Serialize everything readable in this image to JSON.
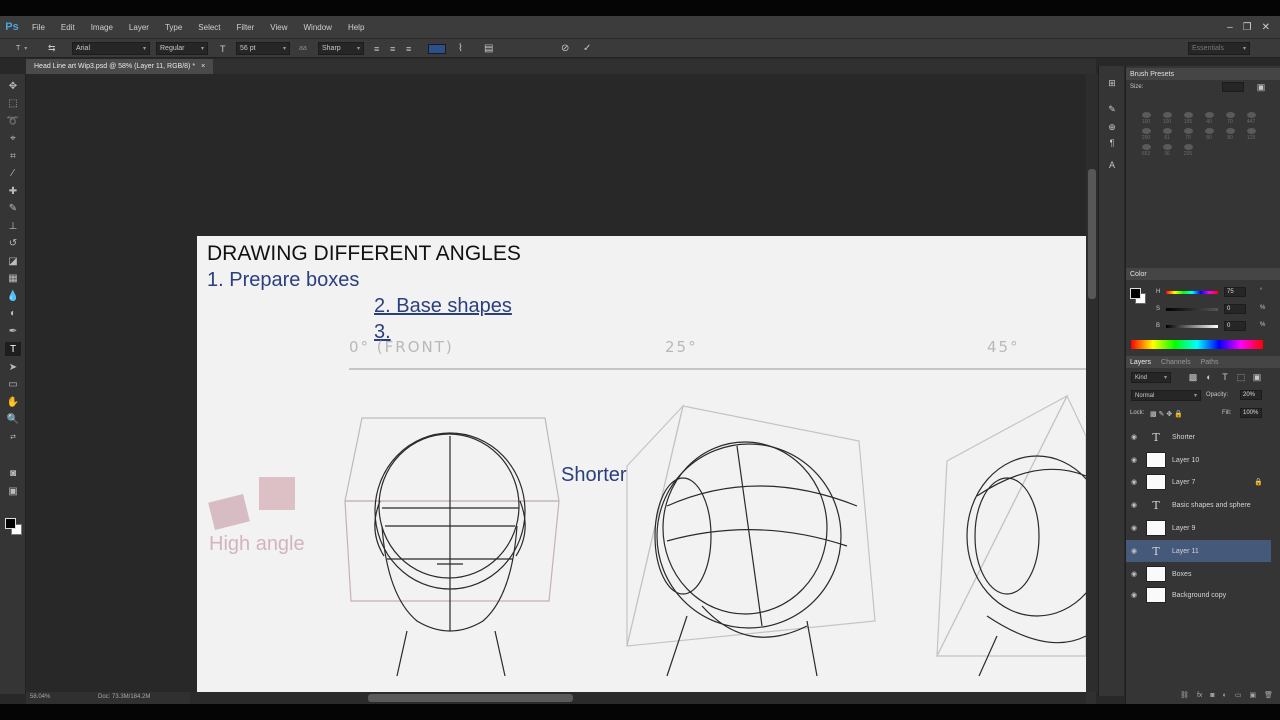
{
  "app": {
    "logo": "Ps"
  },
  "menu": [
    "File",
    "Edit",
    "Image",
    "Layer",
    "Type",
    "Select",
    "Filter",
    "View",
    "Window",
    "Help"
  ],
  "options": {
    "font_family": "Arial",
    "font_style": "Regular",
    "font_size": "56 pt",
    "anti_alias_icon": "aa",
    "anti_alias": "Sharp",
    "workspace": "Essentials"
  },
  "document_tab": {
    "title": "Head Line art Wip3.psd @ 58% (Layer 11, RGB/8) *",
    "close": "×"
  },
  "canvas": {
    "heading": "DRAWING DIFFERENT ANGLES",
    "step1": "1. Prepare boxes",
    "step2": "2. Base shapes",
    "step3": "3.",
    "angle_front": "0° (FRONT)",
    "angle_25": "25°",
    "angle_45": "45°",
    "shorter": "Shorter",
    "high_angle": "High angle"
  },
  "status": {
    "zoom": "58.04%",
    "doc_size": "Doc: 73.3M/184.2M"
  },
  "panels": {
    "brush_presets": {
      "title": "Brush Presets",
      "size_label": "Size:",
      "brush_sizes": [
        "100",
        "100",
        "155",
        "40",
        "70",
        "447",
        "200",
        "81",
        "70",
        "80",
        "80",
        "129",
        "653",
        "36",
        "235",
        "",
        "",
        ""
      ]
    },
    "color": {
      "title": "Color",
      "h_label": "H",
      "h_value": "75",
      "h_unit": "°",
      "s_label": "S",
      "s_value": "0",
      "s_unit": "%",
      "b_label": "B",
      "b_value": "0",
      "b_unit": "%"
    },
    "layers": {
      "tabs": [
        "Layers",
        "Channels",
        "Paths"
      ],
      "kind": "Kind",
      "blend_mode": "Normal",
      "opacity_label": "Opacity:",
      "opacity": "20%",
      "lock_label": "Lock:",
      "fill_label": "Fill:",
      "fill": "100%",
      "items": [
        {
          "name": "Shorter",
          "type": "text",
          "locked": false,
          "selected": false
        },
        {
          "name": "Layer 10",
          "type": "pixel",
          "locked": false,
          "selected": false
        },
        {
          "name": "Layer 7",
          "type": "pixel",
          "locked": true,
          "selected": false
        },
        {
          "name": "Basic shapes and sphere",
          "type": "text",
          "locked": false,
          "selected": false
        },
        {
          "name": "Layer 9",
          "type": "pixel",
          "locked": false,
          "selected": false
        },
        {
          "name": "Layer 11",
          "type": "text",
          "locked": false,
          "selected": true
        },
        {
          "name": "Boxes",
          "type": "pixel",
          "locked": false,
          "selected": false
        },
        {
          "name": "Background copy",
          "type": "pixel",
          "locked": false,
          "selected": false
        }
      ]
    }
  },
  "colors": {
    "accent_blue": "#2a3f7e",
    "selection": "#45597a",
    "text_pink": "#d4b4bc"
  }
}
